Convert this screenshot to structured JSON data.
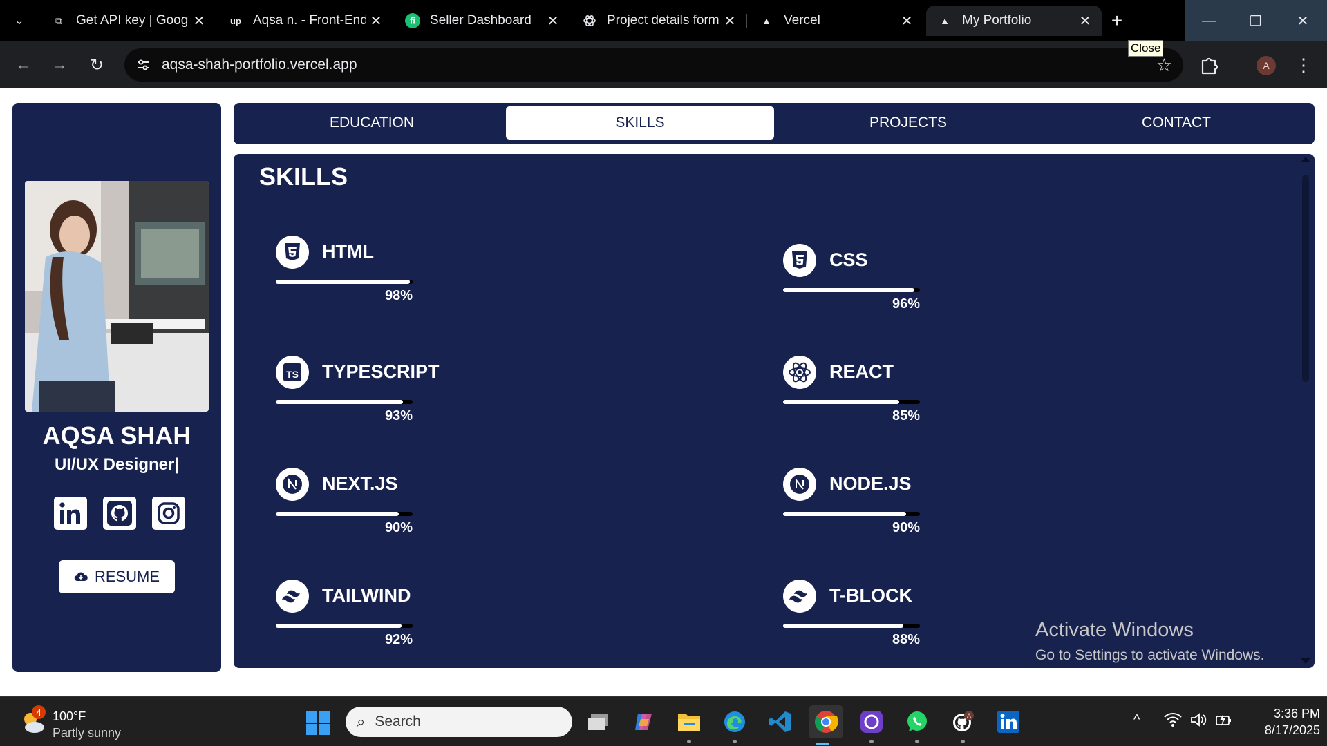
{
  "browser": {
    "tabs": [
      {
        "title": "Get API key | Goog",
        "favicon": "key-page-icon"
      },
      {
        "title": "Aqsa n. - Front-End",
        "favicon": "upwork-icon"
      },
      {
        "title": "Seller Dashboard",
        "favicon": "fiverr-icon"
      },
      {
        "title": "Project details form",
        "favicon": "openai-icon"
      },
      {
        "title": "Vercel",
        "favicon": "vercel-icon"
      },
      {
        "title": "My Portfolio",
        "favicon": "vercel-icon",
        "active": true
      }
    ],
    "url": "aqsa-shah-portfolio.vercel.app",
    "tooltip": "Close",
    "profile_initial": "A"
  },
  "sidebar": {
    "name": "AQSA SHAH",
    "role": "UI/UX Designer|",
    "socials": [
      "linkedin-icon",
      "github-icon",
      "instagram-icon"
    ],
    "resume_label": "RESUME"
  },
  "nav": {
    "tabs": [
      "EDUCATION",
      "SKILLS",
      "PROJECTS",
      "CONTACT"
    ],
    "active": "SKILLS"
  },
  "skills_section": {
    "title": "SKILLS",
    "items": [
      {
        "name": "HTML",
        "percent_label": "98%",
        "percent": 98,
        "icon": "html5-icon"
      },
      {
        "name": "CSS",
        "percent_label": "96%",
        "percent": 96,
        "icon": "css3-icon"
      },
      {
        "name": "TYPESCRIPT",
        "percent_label": "93%",
        "percent": 93,
        "icon": "typescript-icon"
      },
      {
        "name": "REACT",
        "percent_label": "85%",
        "percent": 85,
        "icon": "react-icon"
      },
      {
        "name": "NEXT.JS",
        "percent_label": "90%",
        "percent": 90,
        "icon": "nextjs-icon"
      },
      {
        "name": "NODE.JS",
        "percent_label": "90%",
        "percent": 90,
        "icon": "nextjs-icon"
      },
      {
        "name": "TAILWIND",
        "percent_label": "92%",
        "percent": 92,
        "icon": "tailwind-icon"
      },
      {
        "name": "T-BLOCK",
        "percent_label": "88%",
        "percent": 88,
        "icon": "tailwind-icon"
      }
    ]
  },
  "watermark": {
    "line1": "Activate Windows",
    "line2": "Go to Settings to activate Windows."
  },
  "taskbar": {
    "weather_temp": "100°F",
    "weather_condition": "Partly sunny",
    "weather_badge": "4",
    "search_placeholder": "Search",
    "time": "3:36 PM",
    "date": "8/17/2025"
  },
  "colors": {
    "navy": "#18224f",
    "white": "#ffffff",
    "bar_track": "#000000"
  }
}
